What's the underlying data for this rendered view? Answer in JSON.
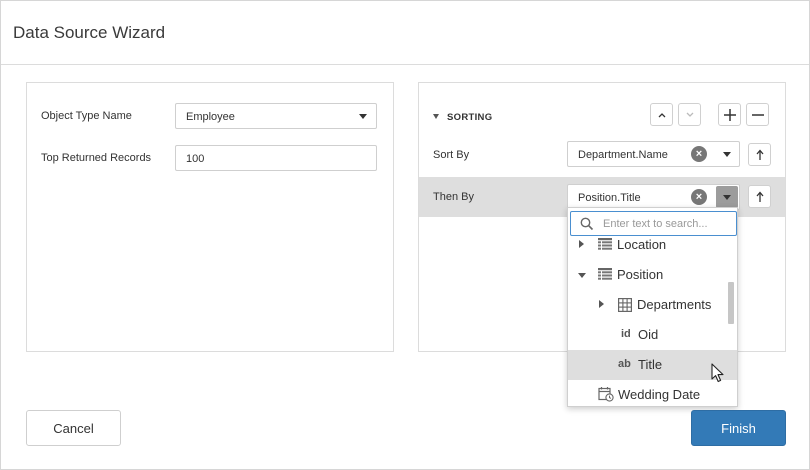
{
  "window": {
    "title": "Data Source Wizard"
  },
  "left_panel": {
    "object_type": {
      "label": "Object Type Name",
      "value": "Employee"
    },
    "top_records": {
      "label": "Top Returned Records",
      "value": "100"
    }
  },
  "sorting": {
    "section_title": "SORTING",
    "sort_by": {
      "label": "Sort By",
      "value": "Department.Name"
    },
    "then_by": {
      "label": "Then By",
      "value": "Position.Title"
    }
  },
  "field_popup": {
    "search_placeholder": "Enter text to search...",
    "items": [
      {
        "label": "Location",
        "icon": "table-list-icon",
        "expander": "collapsed",
        "level": 0
      },
      {
        "label": "Position",
        "icon": "table-list-icon",
        "expander": "expanded",
        "level": 0
      },
      {
        "label": "Departments",
        "icon": "grid-icon",
        "expander": "collapsed",
        "level": 1
      },
      {
        "label": "Oid",
        "glyph": "id",
        "level": 1
      },
      {
        "label": "Title",
        "glyph": "ab",
        "level": 1,
        "selected": true
      },
      {
        "label": "Wedding Date",
        "icon": "calendar-clock-icon",
        "level": 0
      }
    ]
  },
  "footer": {
    "cancel_label": "Cancel",
    "finish_label": "Finish"
  },
  "colors": {
    "primary": "#337ab7",
    "selection": "#dedede",
    "focus_border": "#4a8fd0"
  }
}
